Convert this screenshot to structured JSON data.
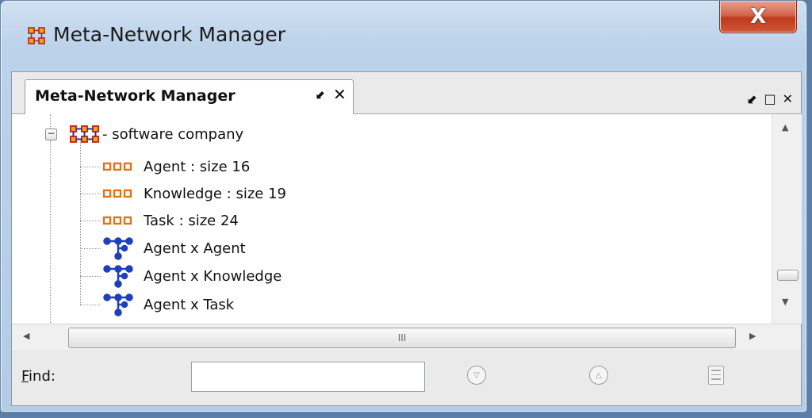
{
  "window": {
    "title": "Meta-Network Manager",
    "close_label": "X"
  },
  "panel": {
    "tab_label": "Meta-Network Manager",
    "tab_restore_glyph": "⬋",
    "tab_close_glyph": "✕",
    "ctrl_restore_glyph": "⬋",
    "ctrl_maximize_glyph": "□",
    "ctrl_close_glyph": "✕"
  },
  "tree": {
    "root": {
      "label": "- software company",
      "icon": "meta-network-icon",
      "expander": "−"
    },
    "children": [
      {
        "label": "Agent : size 16",
        "icon": "node-class-icon"
      },
      {
        "label": "Knowledge : size 19",
        "icon": "node-class-icon"
      },
      {
        "label": "Task : size 24",
        "icon": "node-class-icon"
      },
      {
        "label": "Agent x Agent",
        "icon": "network-icon"
      },
      {
        "label": "Agent x Knowledge",
        "icon": "network-icon"
      },
      {
        "label": "Agent x Task",
        "icon": "network-icon"
      }
    ]
  },
  "scrollbars": {
    "h_thumb_grip": "III"
  },
  "findbar": {
    "label_first": "F",
    "label_rest": "ind:",
    "input_value": "",
    "buttons": [
      "find-next-button",
      "find-previous-button",
      "find-list-button"
    ]
  },
  "colors": {
    "node_class": "#e0741a",
    "network": "#1f3fbf",
    "close_button": "#c94a2d"
  }
}
